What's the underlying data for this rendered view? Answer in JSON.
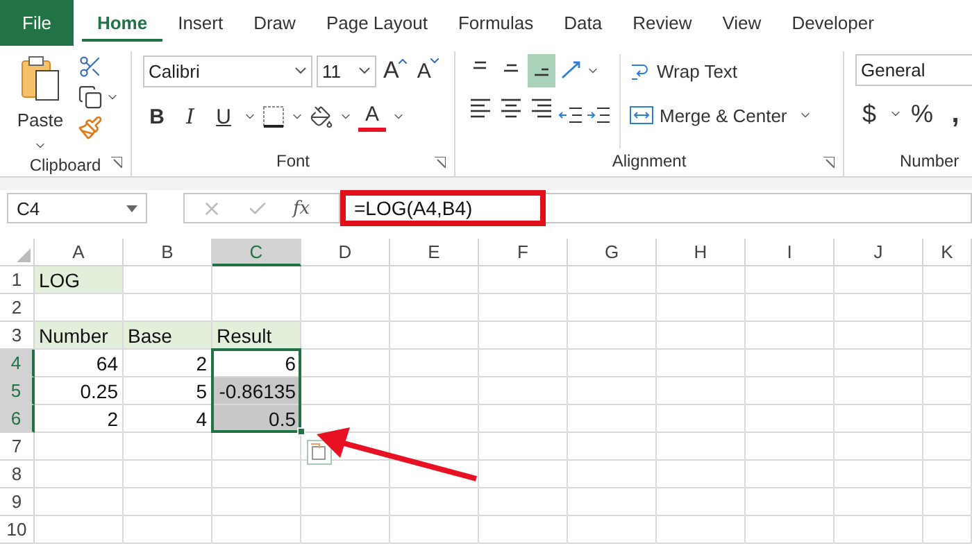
{
  "ribbon_tabs": [
    {
      "label": "File",
      "kind": "file",
      "selected": false
    },
    {
      "label": "Home",
      "kind": "tab",
      "selected": true
    },
    {
      "label": "Insert",
      "kind": "tab",
      "selected": false
    },
    {
      "label": "Draw",
      "kind": "tab",
      "selected": false
    },
    {
      "label": "Page Layout",
      "kind": "tab",
      "selected": false
    },
    {
      "label": "Formulas",
      "kind": "tab",
      "selected": false
    },
    {
      "label": "Data",
      "kind": "tab",
      "selected": false
    },
    {
      "label": "Review",
      "kind": "tab",
      "selected": false
    },
    {
      "label": "View",
      "kind": "tab",
      "selected": false
    },
    {
      "label": "Developer",
      "kind": "tab",
      "selected": false
    }
  ],
  "clipboard": {
    "paste": "Paste",
    "group_label": "Clipboard"
  },
  "font": {
    "name": "Calibri",
    "size": "11",
    "grow": "A",
    "shrink": "A",
    "bold": "B",
    "italic": "I",
    "underline": "U",
    "font_color": "A",
    "group_label": "Font"
  },
  "alignment": {
    "vertical": [
      {
        "selected": false
      },
      {
        "selected": false
      },
      {
        "selected": true
      }
    ],
    "wrap_text": "Wrap Text",
    "merge": "Merge & Center",
    "group_label": "Alignment"
  },
  "number": {
    "format": "General",
    "currency": "$",
    "percent": "%",
    "comma": ",",
    "group_label": "Number"
  },
  "formula_bar": {
    "name_box": "C4",
    "function_label": "fx",
    "formula": "=LOG(A4,B4)",
    "highlighted": true
  },
  "columns": [
    {
      "label": "A",
      "selected": false
    },
    {
      "label": "B",
      "selected": false
    },
    {
      "label": "C",
      "selected": true
    },
    {
      "label": "D",
      "selected": false
    },
    {
      "label": "E",
      "selected": false
    },
    {
      "label": "F",
      "selected": false
    },
    {
      "label": "G",
      "selected": false
    },
    {
      "label": "H",
      "selected": false
    },
    {
      "label": "I",
      "selected": false
    },
    {
      "label": "J",
      "selected": false
    },
    {
      "label": "K",
      "selected": false
    }
  ],
  "rows": [
    {
      "number": "1",
      "selected": false,
      "cells": [
        {
          "text": "LOG",
          "kind": "label"
        },
        {
          "kind": "empty"
        },
        {
          "kind": "empty"
        }
      ]
    },
    {
      "number": "2",
      "selected": false,
      "cells": [
        {
          "kind": "empty"
        },
        {
          "kind": "empty"
        },
        {
          "kind": "empty"
        }
      ]
    },
    {
      "number": "3",
      "selected": false,
      "cells": [
        {
          "text": "Number",
          "kind": "label"
        },
        {
          "text": "Base",
          "kind": "label"
        },
        {
          "text": "Result",
          "kind": "label"
        }
      ]
    },
    {
      "number": "4",
      "selected": true,
      "cells": [
        {
          "text": "64",
          "kind": "number"
        },
        {
          "text": "2",
          "kind": "number"
        },
        {
          "text": "6",
          "kind": "number",
          "selected": true,
          "active": true
        }
      ]
    },
    {
      "number": "5",
      "selected": true,
      "cells": [
        {
          "text": "0.25",
          "kind": "number"
        },
        {
          "text": "5",
          "kind": "number"
        },
        {
          "text": "-0.86135",
          "kind": "number",
          "selected": true,
          "active": false
        }
      ]
    },
    {
      "number": "6",
      "selected": true,
      "cells": [
        {
          "text": "2",
          "kind": "number"
        },
        {
          "text": "4",
          "kind": "number"
        },
        {
          "text": "0.5",
          "kind": "number",
          "selected": true,
          "active": false
        }
      ]
    },
    {
      "number": "7",
      "selected": false,
      "cells": [
        {
          "kind": "empty"
        },
        {
          "kind": "empty"
        },
        {
          "kind": "empty"
        }
      ]
    },
    {
      "number": "8",
      "selected": false,
      "cells": [
        {
          "kind": "empty"
        },
        {
          "kind": "empty"
        },
        {
          "kind": "empty"
        }
      ]
    },
    {
      "number": "9",
      "selected": false,
      "cells": [
        {
          "kind": "empty"
        },
        {
          "kind": "empty"
        },
        {
          "kind": "empty"
        }
      ]
    },
    {
      "number": "10",
      "selected": false,
      "cells": [
        {
          "kind": "empty"
        },
        {
          "kind": "empty"
        },
        {
          "kind": "empty"
        }
      ]
    }
  ],
  "annotation": {
    "kind": "arrow"
  }
}
